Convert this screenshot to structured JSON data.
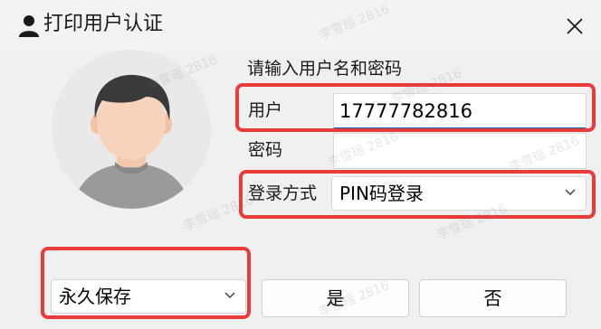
{
  "window": {
    "title": "打印用户认证",
    "close_glyph": "✕"
  },
  "form": {
    "prompt": "请输入用户名和密码",
    "user_label": "用户",
    "user_value": "17777782816",
    "password_label": "密码",
    "password_value": "",
    "login_method_label": "登录方式",
    "login_method_value": "PIN码登录",
    "save_option_value": "永久保存"
  },
  "buttons": {
    "yes": "是",
    "no": "否"
  },
  "watermark": {
    "text": "李雪瑶 2816"
  },
  "colors": {
    "highlight": "#ea3b3b",
    "focus_accent": "#0067c0"
  },
  "icons": {
    "title": "user-icon",
    "close": "close-icon",
    "dropdown": "chevron-down-icon",
    "avatar": "default-avatar"
  }
}
